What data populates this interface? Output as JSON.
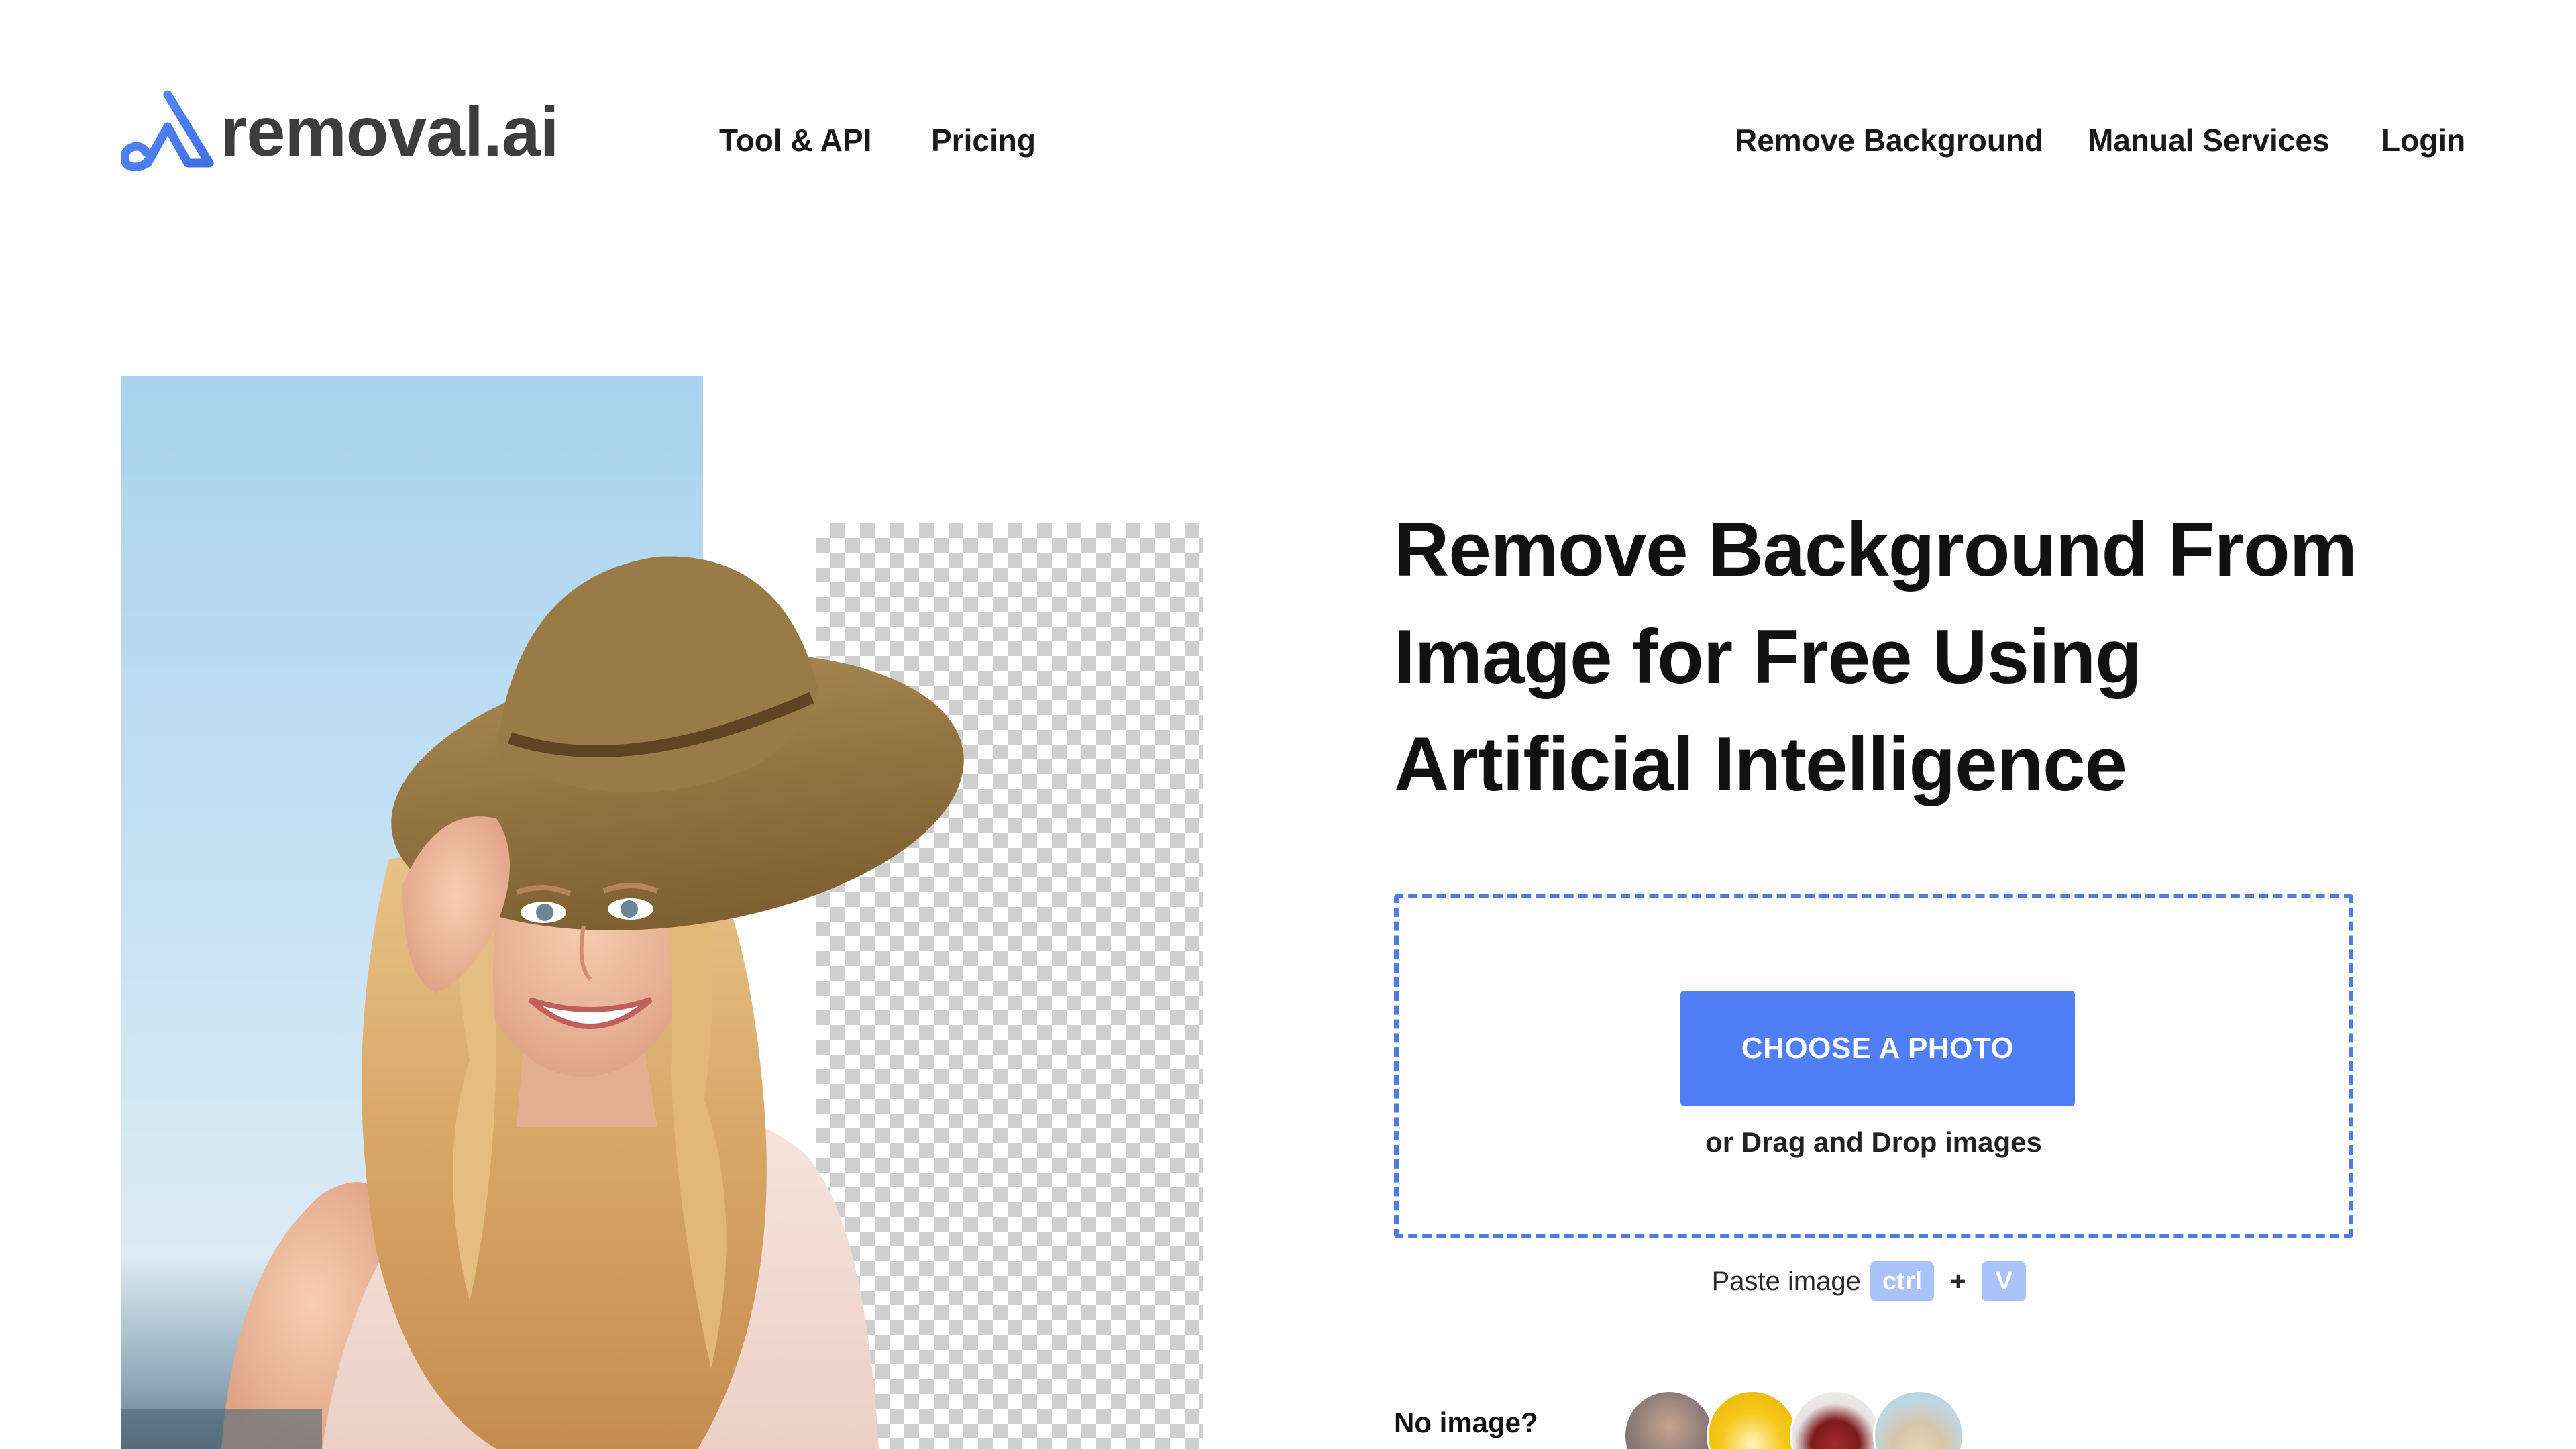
{
  "brand": {
    "name": "removal.ai",
    "accent_color": "#4f7ef5",
    "logo_icon": "removal-ai-logo-icon"
  },
  "nav": {
    "left_links": [
      "Tool & API",
      "Pricing"
    ],
    "right_links": [
      "Remove Background",
      "Manual Services",
      "Login"
    ]
  },
  "hero": {
    "headline_lines": [
      "Remove Background From",
      "Image for Free Using",
      "Artificial Intelligence"
    ]
  },
  "upload": {
    "button_label": "CHOOSE A PHOTO",
    "drag_text": "or Drag and Drop images",
    "paste_label": "Paste image",
    "paste_key_1": "ctrl",
    "paste_plus": "+",
    "paste_key_2": "V",
    "border_color": "#4d7de4"
  },
  "samples": {
    "label": "No image?",
    "items": [
      "sample-couple-icon",
      "sample-camera-icon",
      "sample-backpack-icon",
      "sample-dog-icon"
    ]
  }
}
